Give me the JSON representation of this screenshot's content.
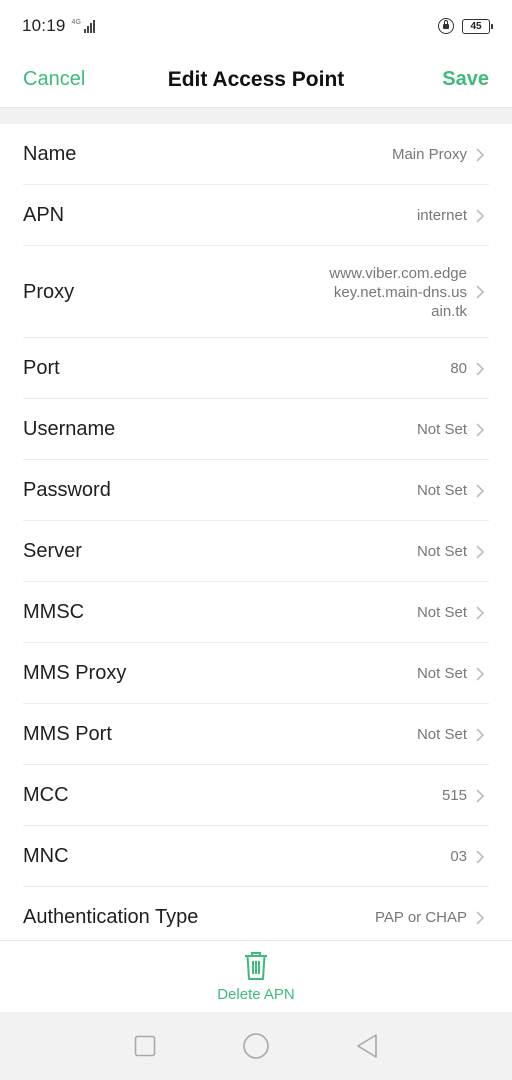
{
  "status": {
    "time": "10:19",
    "network_label": "4G",
    "battery": "45"
  },
  "header": {
    "cancel_label": "Cancel",
    "title": "Edit Access Point",
    "save_label": "Save"
  },
  "fields": [
    {
      "label": "Name",
      "value": "Main Proxy"
    },
    {
      "label": "APN",
      "value": "internet"
    },
    {
      "label": "Proxy",
      "value": "www.viber.com.edgekey.net.main-dns.usain.tk"
    },
    {
      "label": "Port",
      "value": "80"
    },
    {
      "label": "Username",
      "value": "Not Set"
    },
    {
      "label": "Password",
      "value": "Not Set"
    },
    {
      "label": "Server",
      "value": "Not Set"
    },
    {
      "label": "MMSC",
      "value": "Not Set"
    },
    {
      "label": "MMS Proxy",
      "value": "Not Set"
    },
    {
      "label": "MMS Port",
      "value": "Not Set"
    },
    {
      "label": "MCC",
      "value": "515"
    },
    {
      "label": "MNC",
      "value": "03"
    },
    {
      "label": "Authentication Type",
      "value": "PAP or CHAP"
    }
  ],
  "footer": {
    "delete_label": "Delete APN"
  },
  "colors": {
    "accent": "#3fba7d"
  },
  "icons": {
    "chevron": "chevron-right-icon",
    "delete": "trash-icon",
    "nav": [
      "recents-square-icon",
      "home-circle-icon",
      "back-triangle-icon"
    ]
  }
}
